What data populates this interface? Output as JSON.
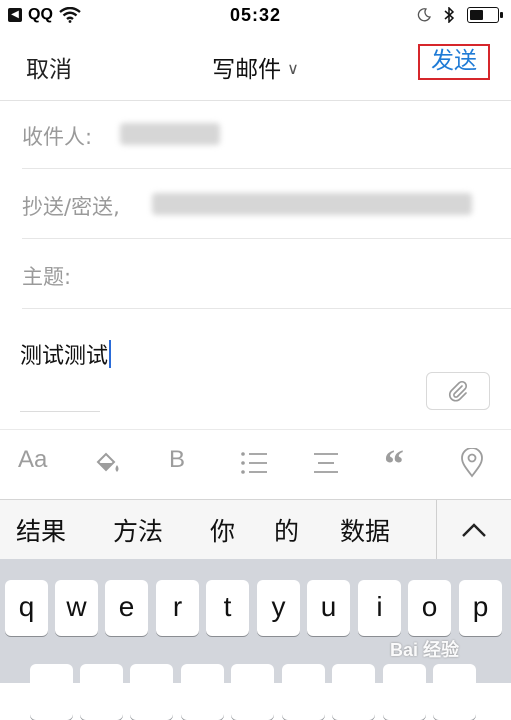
{
  "status_bar": {
    "carrier": "QQ",
    "time": "05:32",
    "battery_level": 0.55
  },
  "nav": {
    "cancel": "取消",
    "title": "写邮件",
    "send": "发送"
  },
  "fields": {
    "to_label": "收件人:",
    "cc_label": "抄送/密送,",
    "subject_label": "主题:"
  },
  "body": {
    "text": "测试测试"
  },
  "suggestions": [
    "结果",
    "方法",
    "你",
    "的",
    "数据"
  ],
  "keys_row1": [
    "q",
    "w",
    "e",
    "r",
    "t",
    "y",
    "u",
    "i",
    "o",
    "p"
  ],
  "watermark": "Bai 经验"
}
